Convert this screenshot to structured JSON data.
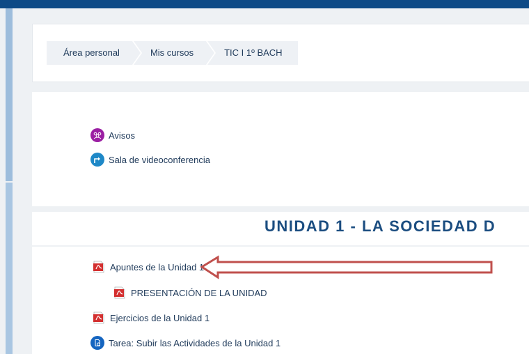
{
  "breadcrumb": {
    "items": [
      "Área personal",
      "Mis cursos",
      "TIC I 1º BACH"
    ]
  },
  "top_activities": [
    {
      "label": "Avisos",
      "icon": "forum-icon",
      "color": "#9b1fa3"
    },
    {
      "label": "Sala de videoconferencia",
      "icon": "url-icon",
      "color": "#1e88c7"
    }
  ],
  "section": {
    "title": "UNIDAD 1 - LA SOCIEDAD D"
  },
  "unit_activities": [
    {
      "label": "Apuntes de la Unidad 1",
      "icon": "pdf-icon"
    },
    {
      "label": "PRESENTACIÓN DE LA UNIDAD",
      "icon": "pdf-icon"
    },
    {
      "label": "Ejercicios de la Unidad 1",
      "icon": "pdf-icon"
    },
    {
      "label": "Tarea: Subir las Actividades de la Unidad 1",
      "icon": "assignment-icon",
      "color": "#1565c0"
    }
  ],
  "colors": {
    "topbar": "#0e4a86",
    "accent": "#1b4d80",
    "arrow": "#c0504d",
    "pdf_red": "#d32f2f"
  }
}
